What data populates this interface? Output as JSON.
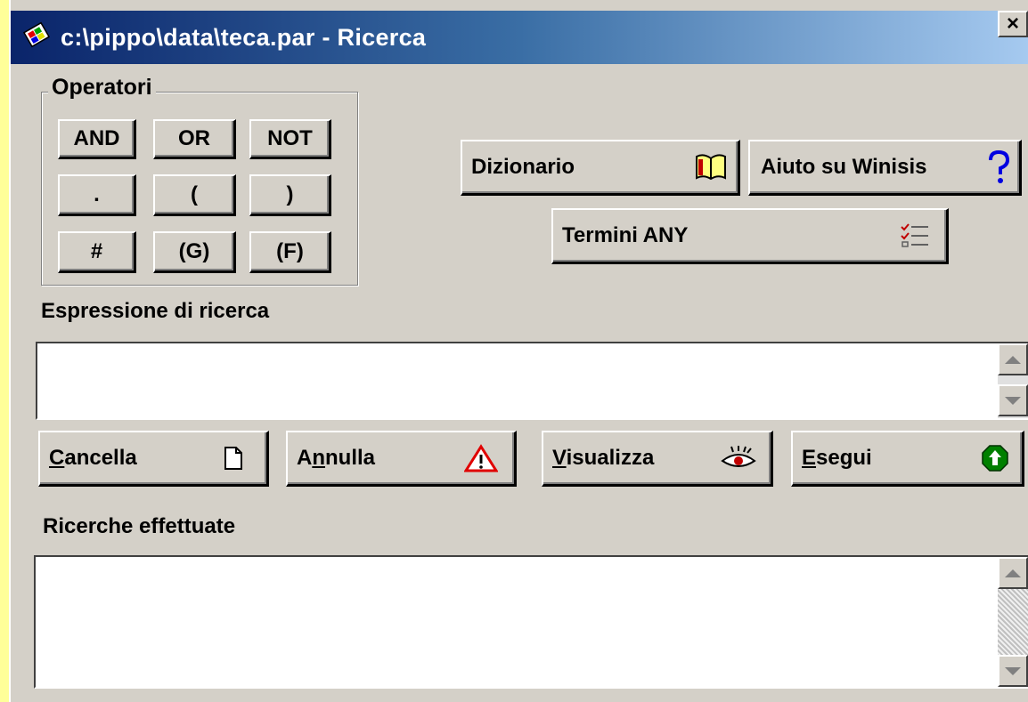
{
  "window": {
    "title": "c:\\pippo\\data\\teca.par - Ricerca",
    "close_label": "×"
  },
  "operators": {
    "group_label": "Operatori",
    "buttons": [
      "AND",
      "OR",
      "NOT",
      ".",
      "(",
      ")",
      "#",
      "(G)",
      "(F)"
    ]
  },
  "tools": {
    "dizionario_label": "Dizionario",
    "aiuto_label": "Aiuto su Winisis",
    "termini_label": "Termini ANY"
  },
  "search": {
    "expression_label": "Espressione di ricerca",
    "expression_value": ""
  },
  "actions": {
    "cancella": {
      "accel": "C",
      "rest": "ancella"
    },
    "annulla": {
      "accel": "n",
      "pre": "A",
      "rest": "nulla"
    },
    "visualizza": {
      "accel": "V",
      "rest": "isualizza"
    },
    "esegui": {
      "accel": "E",
      "rest": "segui"
    }
  },
  "history": {
    "label": "Ricerche effettuate",
    "value": ""
  },
  "icons": {
    "app": "winisis-app-icon",
    "dizionario": "book-icon",
    "aiuto": "question-mark-icon",
    "termini": "checklist-icon",
    "cancella": "new-page-icon",
    "annulla": "warning-icon",
    "visualizza": "eye-icon",
    "esegui": "go-up-arrow-icon"
  },
  "colors": {
    "title_bar_start": "#0a246a",
    "title_bar_end": "#a6caf0",
    "dialog_bg": "#d4d0c8",
    "page_bg": "#ffff99",
    "warning_red": "#e00000",
    "go_green": "#008000",
    "help_blue": "#0000e0"
  }
}
